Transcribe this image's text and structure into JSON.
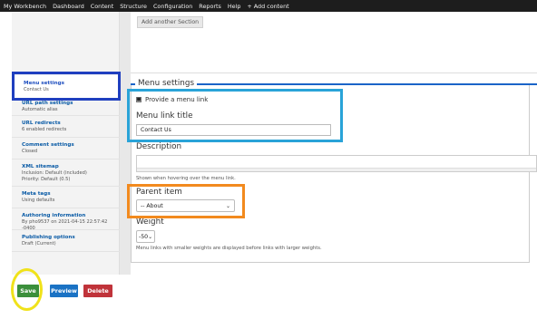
{
  "toolbar": {
    "items": [
      "My Workbench",
      "Dashboard",
      "Content",
      "Structure",
      "Configuration",
      "Reports",
      "Help",
      "+ Add content"
    ]
  },
  "layout_builder": {
    "add_section_label": "Add another Section"
  },
  "sidebar": {
    "items": [
      {
        "title": "Menu settings",
        "subtitle": "Contact Us"
      },
      {
        "title": "URL path settings",
        "subtitle": "Automatic alias"
      },
      {
        "title": "URL redirects",
        "subtitle": "6 enabled redirects"
      },
      {
        "title": "Comment settings",
        "subtitle": "Closed"
      },
      {
        "title": "XML sitemap",
        "subtitle": "Inclusion: Default (included)",
        "subtitle2": "Priority: Default (0.5)"
      },
      {
        "title": "Meta tags",
        "subtitle": "Using defaults"
      },
      {
        "title": "Authoring information",
        "subtitle": "By pho9537 on 2021-04-15 22:57:42 -0400"
      },
      {
        "title": "Publishing options",
        "subtitle": "Draft (Current)"
      }
    ]
  },
  "menu_settings": {
    "legend": "Menu settings",
    "provide_link_label": "Provide a menu link",
    "provide_link_checked": true,
    "menu_link_title_label": "Menu link title",
    "menu_link_title_value": "Contact Us",
    "description_label": "Description",
    "description_value": "",
    "description_help": "Shown when hovering over the menu link.",
    "parent_item_label": "Parent item",
    "parent_item_value": "-- About",
    "weight_label": "Weight",
    "weight_value": "-50",
    "weight_help": "Menu links with smaller weights are displayed before links with larger weights."
  },
  "actions": {
    "save": "Save",
    "preview": "Preview",
    "delete": "Delete"
  },
  "colors": {
    "save": "#3b8f3b",
    "preview": "#1a72c4",
    "delete": "#c0333a",
    "annotation_blue": "#1f3fbf",
    "annotation_cyan": "#29a3d8",
    "annotation_orange": "#f28a1e",
    "annotation_yellow": "#f0e21a"
  }
}
